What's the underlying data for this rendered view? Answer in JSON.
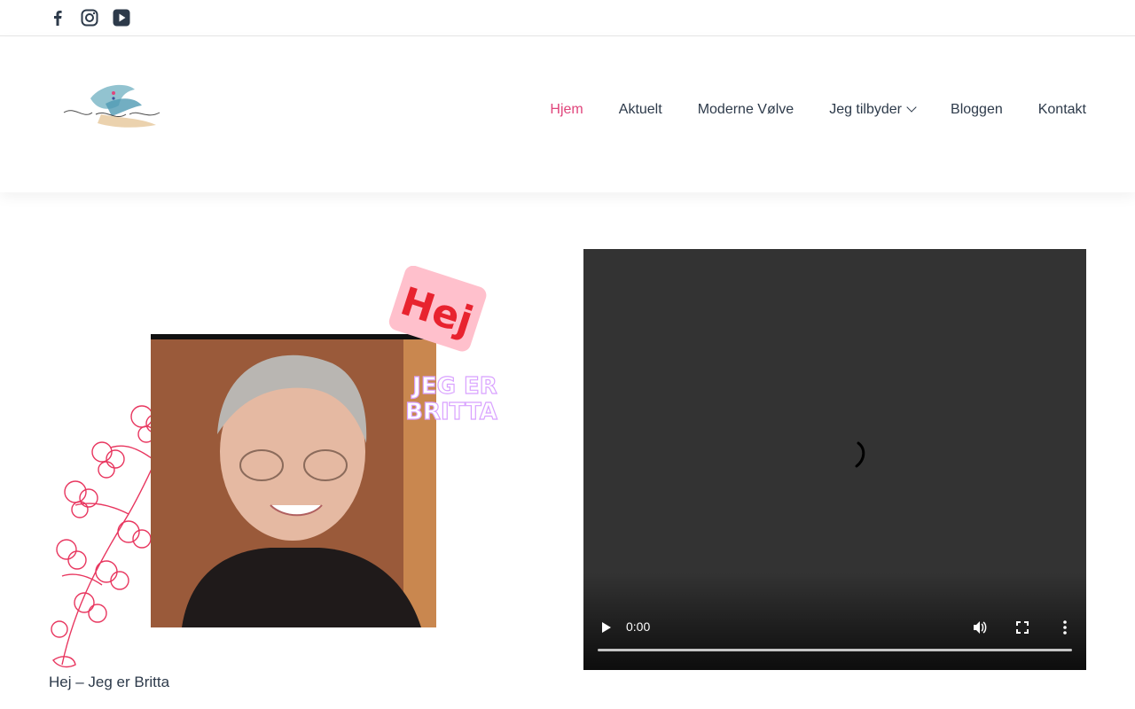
{
  "social": {
    "items": [
      {
        "name": "facebook-icon"
      },
      {
        "name": "instagram-icon"
      },
      {
        "name": "youtube-icon"
      }
    ]
  },
  "nav": {
    "items": [
      "Hjem",
      "Aktuelt",
      "Moderne Vølve",
      "Jeg tilbyder",
      "Bloggen",
      "Kontakt"
    ],
    "active": "Hjem"
  },
  "hero": {
    "sticker_hej": "Hej",
    "sticker_line1": "JEG ER",
    "sticker_line2": "BRITTA",
    "caption": "Hej – Jeg er Britta"
  },
  "video": {
    "time": "0:00"
  },
  "colors": {
    "accent": "#e0457b",
    "text": "#2d3a4a",
    "video_bg": "#333333"
  }
}
